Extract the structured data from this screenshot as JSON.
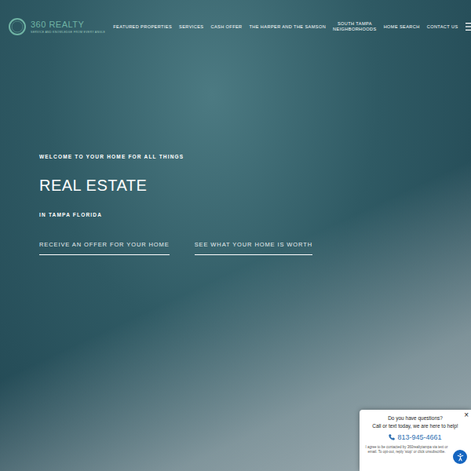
{
  "logo": {
    "name": "360 REALTY",
    "tagline": "SERVICE AND KNOWLEDGE FROM EVERY ANGLE"
  },
  "nav": [
    {
      "label": "FEATURED PROPERTIES"
    },
    {
      "label": "SERVICES"
    },
    {
      "label": "CASH OFFER"
    },
    {
      "label": "THE HARPER AND THE SAMSON"
    },
    {
      "label": "SOUTH TAMPA NEIGHBORHOODS"
    },
    {
      "label": "HOME SEARCH"
    },
    {
      "label": "CONTACT US"
    }
  ],
  "hero": {
    "eyebrow": "WELCOME TO YOUR HOME FOR ALL THINGS",
    "title": "REAL ESTATE",
    "subtitle": "IN TAMPA FLORIDA",
    "links": [
      {
        "label": "RECEIVE AN OFFER FOR YOUR HOME"
      },
      {
        "label": "SEE WHAT YOUR HOME IS WORTH"
      }
    ]
  },
  "chat": {
    "close": "×",
    "title": "Do you have questions?",
    "message": "Call or text today, we are here to help!",
    "phone": "813-945-4661",
    "disclaimer": "I agree to be contacted by 360realtytampa via text or email. To opt-out, reply 'stop' or click unsubscribe."
  }
}
